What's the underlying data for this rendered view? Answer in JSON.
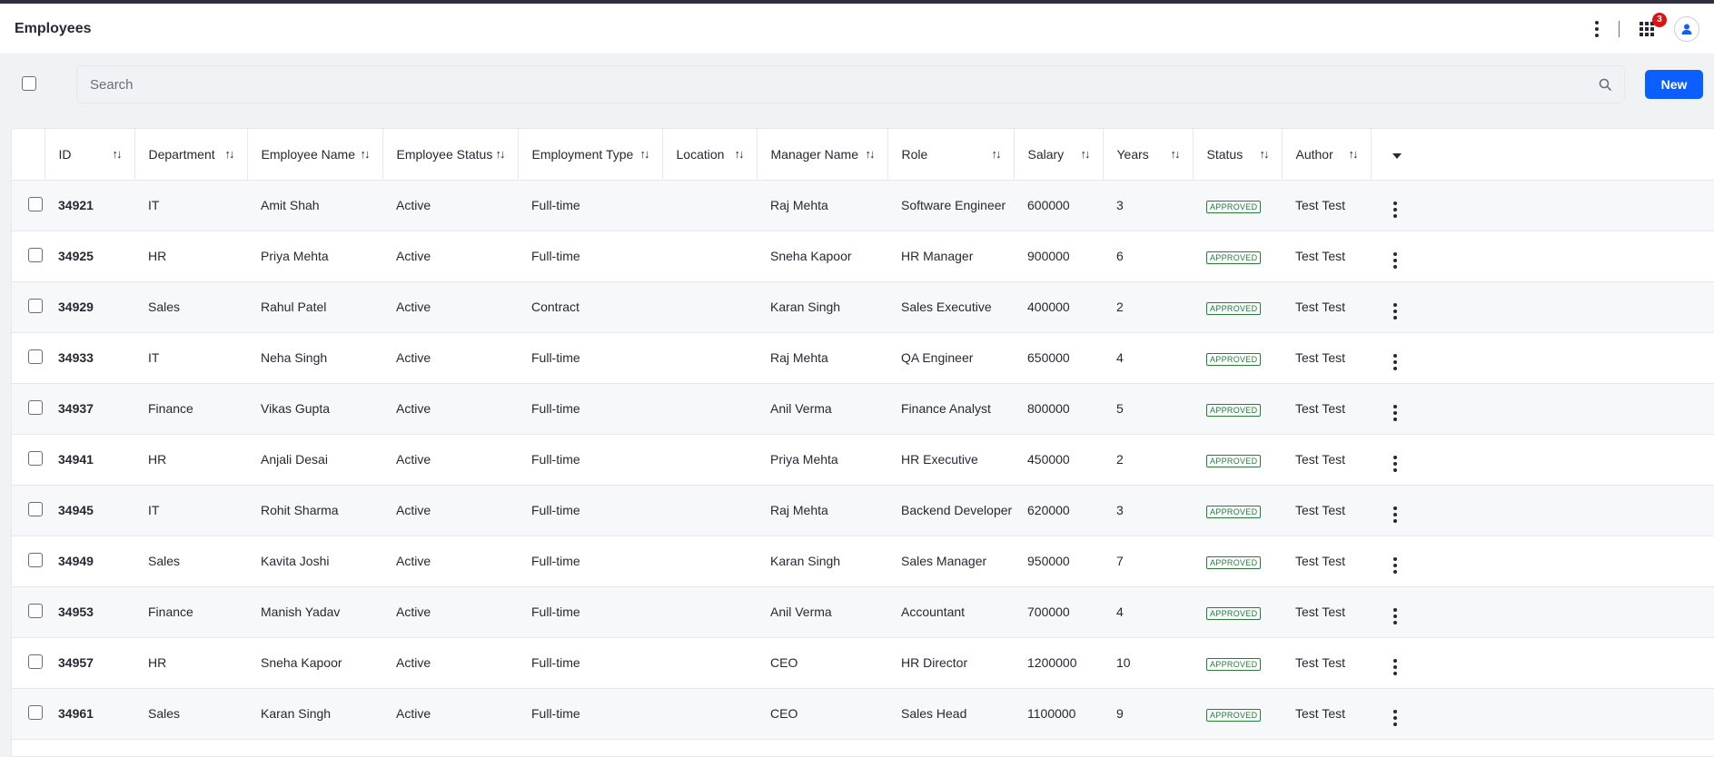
{
  "header": {
    "title": "Employees",
    "notification_count": "3"
  },
  "toolbar": {
    "search_placeholder": "Search",
    "new_label": "New"
  },
  "table": {
    "columns": [
      {
        "label": "ID",
        "sortable": true
      },
      {
        "label": "Department",
        "sortable": true
      },
      {
        "label": "Employee Name",
        "sortable": true
      },
      {
        "label": "Employee Status",
        "sortable": true
      },
      {
        "label": "Employment Type",
        "sortable": true
      },
      {
        "label": "Location",
        "sortable": true
      },
      {
        "label": "Manager Name",
        "sortable": true
      },
      {
        "label": "Role",
        "sortable": true
      },
      {
        "label": "Salary",
        "sortable": true
      },
      {
        "label": "Years",
        "sortable": true
      },
      {
        "label": "Status",
        "sortable": true
      },
      {
        "label": "Author",
        "sortable": true
      }
    ],
    "rows": [
      {
        "id": "34921",
        "department": "IT",
        "name": "Amit Shah",
        "employee_status": "Active",
        "employment_type": "Full-time",
        "location": "",
        "manager": "Raj Mehta",
        "role": "Software Engineer",
        "salary": "600000",
        "years": "3",
        "status": "APPROVED",
        "author": "Test Test"
      },
      {
        "id": "34925",
        "department": "HR",
        "name": "Priya Mehta",
        "employee_status": "Active",
        "employment_type": "Full-time",
        "location": "",
        "manager": "Sneha Kapoor",
        "role": "HR Manager",
        "salary": "900000",
        "years": "6",
        "status": "APPROVED",
        "author": "Test Test"
      },
      {
        "id": "34929",
        "department": "Sales",
        "name": "Rahul Patel",
        "employee_status": "Active",
        "employment_type": "Contract",
        "location": "",
        "manager": "Karan Singh",
        "role": "Sales Executive",
        "salary": "400000",
        "years": "2",
        "status": "APPROVED",
        "author": "Test Test"
      },
      {
        "id": "34933",
        "department": "IT",
        "name": "Neha Singh",
        "employee_status": "Active",
        "employment_type": "Full-time",
        "location": "",
        "manager": "Raj Mehta",
        "role": "QA Engineer",
        "salary": "650000",
        "years": "4",
        "status": "APPROVED",
        "author": "Test Test"
      },
      {
        "id": "34937",
        "department": "Finance",
        "name": "Vikas Gupta",
        "employee_status": "Active",
        "employment_type": "Full-time",
        "location": "",
        "manager": "Anil Verma",
        "role": "Finance Analyst",
        "salary": "800000",
        "years": "5",
        "status": "APPROVED",
        "author": "Test Test"
      },
      {
        "id": "34941",
        "department": "HR",
        "name": "Anjali Desai",
        "employee_status": "Active",
        "employment_type": "Full-time",
        "location": "",
        "manager": "Priya Mehta",
        "role": "HR Executive",
        "salary": "450000",
        "years": "2",
        "status": "APPROVED",
        "author": "Test Test"
      },
      {
        "id": "34945",
        "department": "IT",
        "name": "Rohit Sharma",
        "employee_status": "Active",
        "employment_type": "Full-time",
        "location": "",
        "manager": "Raj Mehta",
        "role": "Backend Developer",
        "salary": "620000",
        "years": "3",
        "status": "APPROVED",
        "author": "Test Test"
      },
      {
        "id": "34949",
        "department": "Sales",
        "name": "Kavita Joshi",
        "employee_status": "Active",
        "employment_type": "Full-time",
        "location": "",
        "manager": "Karan Singh",
        "role": "Sales Manager",
        "salary": "950000",
        "years": "7",
        "status": "APPROVED",
        "author": "Test Test"
      },
      {
        "id": "34953",
        "department": "Finance",
        "name": "Manish Yadav",
        "employee_status": "Active",
        "employment_type": "Full-time",
        "location": "",
        "manager": "Anil Verma",
        "role": "Accountant",
        "salary": "700000",
        "years": "4",
        "status": "APPROVED",
        "author": "Test Test"
      },
      {
        "id": "34957",
        "department": "HR",
        "name": "Sneha Kapoor",
        "employee_status": "Active",
        "employment_type": "Full-time",
        "location": "",
        "manager": "CEO",
        "role": "HR Director",
        "salary": "1200000",
        "years": "10",
        "status": "APPROVED",
        "author": "Test Test"
      },
      {
        "id": "34961",
        "department": "Sales",
        "name": "Karan Singh",
        "employee_status": "Active",
        "employment_type": "Full-time",
        "location": "",
        "manager": "CEO",
        "role": "Sales Head",
        "salary": "1100000",
        "years": "9",
        "status": "APPROVED",
        "author": "Test Test"
      }
    ]
  },
  "colors": {
    "primary": "#0b5fff",
    "approved": "#287d3c",
    "badge": "#da1414"
  }
}
